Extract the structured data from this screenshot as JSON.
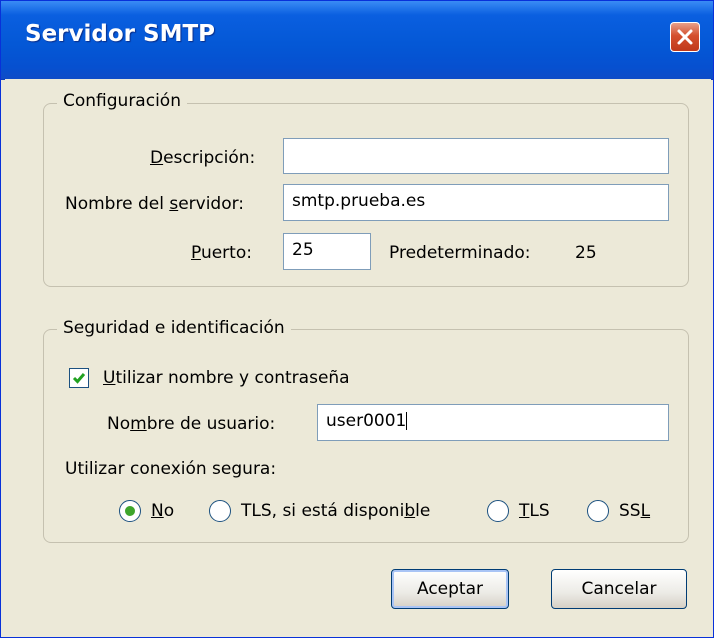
{
  "window": {
    "title": "Servidor SMTP"
  },
  "config": {
    "group_label": "Configuración",
    "descripcion": {
      "label_pre": "",
      "label_u": "D",
      "label_post": "escripción:",
      "value": ""
    },
    "servidor": {
      "label_pre": "Nombre del ",
      "label_u": "s",
      "label_post": "ervidor:",
      "value": "smtp.prueba.es"
    },
    "puerto": {
      "label_pre": "",
      "label_u": "P",
      "label_post": "uerto:",
      "value": "25"
    },
    "predeterminado_label": "Predeterminado:",
    "predeterminado_value": "25"
  },
  "security": {
    "group_label": "Seguridad e identificación",
    "use_auth": {
      "label_pre": "",
      "label_u": "U",
      "label_post": "tilizar nombre y contraseña",
      "checked": true
    },
    "username": {
      "label_pre": "No",
      "label_u": "m",
      "label_post": "bre de usuario:",
      "value": "user0001"
    },
    "secure_label": "Utilizar conexión segura:",
    "options": [
      {
        "pre": "",
        "u": "N",
        "post": "o",
        "selected": true
      },
      {
        "pre": "TLS, si está disponi",
        "u": "b",
        "post": "le",
        "selected": false
      },
      {
        "pre": "",
        "u": "T",
        "post": "LS",
        "selected": false
      },
      {
        "pre": "SS",
        "u": "L",
        "post": "",
        "selected": false
      }
    ]
  },
  "buttons": {
    "ok": "Aceptar",
    "cancel": "Cancelar"
  },
  "colors": {
    "title_bar": "#0458d6",
    "close_button": "#d4502e",
    "radio_selected": "#3ea52b",
    "dialog_bg": "#ece9d8"
  }
}
